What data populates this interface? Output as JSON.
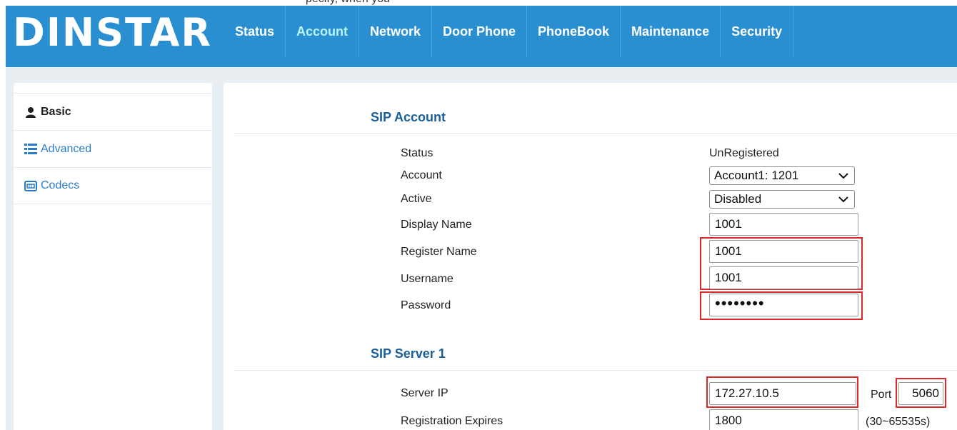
{
  "header": {
    "top_partial_text": "pecify, when you",
    "logo": "DINSTAR",
    "nav": [
      {
        "label": "Status",
        "active": false
      },
      {
        "label": "Account",
        "active": true
      },
      {
        "label": "Network",
        "active": false
      },
      {
        "label": "Door Phone",
        "active": false
      },
      {
        "label": "PhoneBook",
        "active": false
      },
      {
        "label": "Maintenance",
        "active": false
      },
      {
        "label": "Security",
        "active": false
      }
    ]
  },
  "sidebar": {
    "items": [
      {
        "label": "Basic",
        "icon": "user-icon",
        "active": true
      },
      {
        "label": "Advanced",
        "icon": "list-icon",
        "active": false
      },
      {
        "label": "Codecs",
        "icon": "codec-icon",
        "active": false
      }
    ]
  },
  "sip_account": {
    "title": "SIP Account",
    "status_label": "Status",
    "status_value": "UnRegistered",
    "account_label": "Account",
    "account_value": "Account1: 1201",
    "active_label": "Active",
    "active_value": "Disabled",
    "display_name_label": "Display Name",
    "display_name_value": "1001",
    "register_name_label": "Register Name",
    "register_name_value": "1001",
    "username_label": "Username",
    "username_value": "1001",
    "password_label": "Password",
    "password_value": "••••••••"
  },
  "sip_server": {
    "title": "SIP Server 1",
    "server_ip_label": "Server IP",
    "server_ip_value": "172.27.10.5",
    "port_label": "Port",
    "port_value": "5060",
    "expires_label": "Registration Expires",
    "expires_value": "1800",
    "expires_range": "(30~65535s)"
  },
  "colors": {
    "header_bg": "#2a8fd0",
    "highlight": "#e0282a",
    "title": "#1a5f99",
    "link": "#2a7cc7"
  }
}
